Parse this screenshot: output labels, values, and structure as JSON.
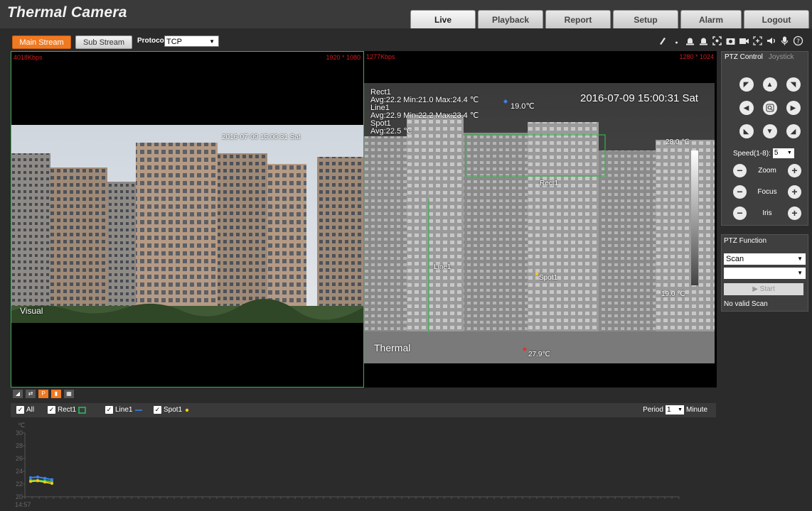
{
  "app": {
    "title": "Thermal Camera"
  },
  "nav": {
    "tabs": [
      "Live",
      "Playback",
      "Report",
      "Setup",
      "Alarm",
      "Logout"
    ],
    "active": "Live"
  },
  "toolbar": {
    "main_stream": "Main Stream",
    "sub_stream": "Sub Stream",
    "protocol_label": "Protocol",
    "protocol_value": "TCP",
    "icons": [
      "pen-icon",
      "dot-icon",
      "alarm-light-icon",
      "alarm-light-2-icon",
      "focus-frame-icon",
      "snapshot-icon",
      "record-icon",
      "zoom-icon",
      "audio-icon",
      "microphone-icon",
      "help-icon"
    ]
  },
  "visual": {
    "bitrate": "4018Kbps",
    "resolution": "1920 * 1080",
    "timestamp": "2016-07-09 15:00:31 Sat",
    "label": "Visual"
  },
  "thermal": {
    "bitrate": "1277Kbps",
    "resolution": "1280 * 1024",
    "timestamp": "2016-07-09 15:00:31 Sat",
    "label": "Thermal",
    "stats": {
      "rect_name": "Rect1",
      "rect_stats": "Avg:22.2 Min:21.0 Max:24.4 ℃",
      "line_name": "Line1",
      "line_stats": "Avg:22.9 Min:22.2 Max:23.4 ℃",
      "spot_name": "Spot1",
      "spot_stats": "Avg:22.5 ℃"
    },
    "cold_marker": "19.0℃",
    "hot_marker": "27.9℃",
    "scale_max": "28.0 ℃",
    "scale_min": "19.0 ℃",
    "rect_label": "Rect1",
    "line_label": "Line1",
    "spot_label": "Spot1"
  },
  "ptz": {
    "tab_control": "PTZ Control",
    "tab_joystick": "Joystick",
    "speed_label": "Speed(1-8):",
    "speed_value": "5",
    "zoom_label": "Zoom",
    "focus_label": "Focus",
    "iris_label": "Iris",
    "function_title": "PTZ Function",
    "function_value": "Scan",
    "function_sub_value": "",
    "start_label": "▶ Start",
    "status": "No valid Scan"
  },
  "legend": {
    "all_label": "All",
    "items": [
      {
        "name": "Rect1",
        "color": "#22c55e"
      },
      {
        "name": "Line1",
        "color": "#3b82f6"
      },
      {
        "name": "Spot1",
        "color": "#facc15"
      }
    ],
    "period_label": "Period",
    "period_value": "1",
    "period_unit": "Minute"
  },
  "chart_data": {
    "type": "line",
    "ylabel": "℃",
    "ylim": [
      20,
      30
    ],
    "yticks": [
      "30",
      "28",
      "26",
      "24",
      "22",
      "20"
    ],
    "x": [
      "14:57"
    ],
    "series": [
      {
        "name": "Rect1",
        "color": "#22c55e",
        "values": [
          22.6,
          22.6,
          22.5,
          22.4
        ]
      },
      {
        "name": "Line1",
        "color": "#3b82f6",
        "values": [
          23.0,
          23.1,
          22.9,
          22.7
        ]
      },
      {
        "name": "Spot1",
        "color": "#facc15",
        "values": [
          22.4,
          22.5,
          22.3,
          22.1
        ]
      }
    ]
  }
}
